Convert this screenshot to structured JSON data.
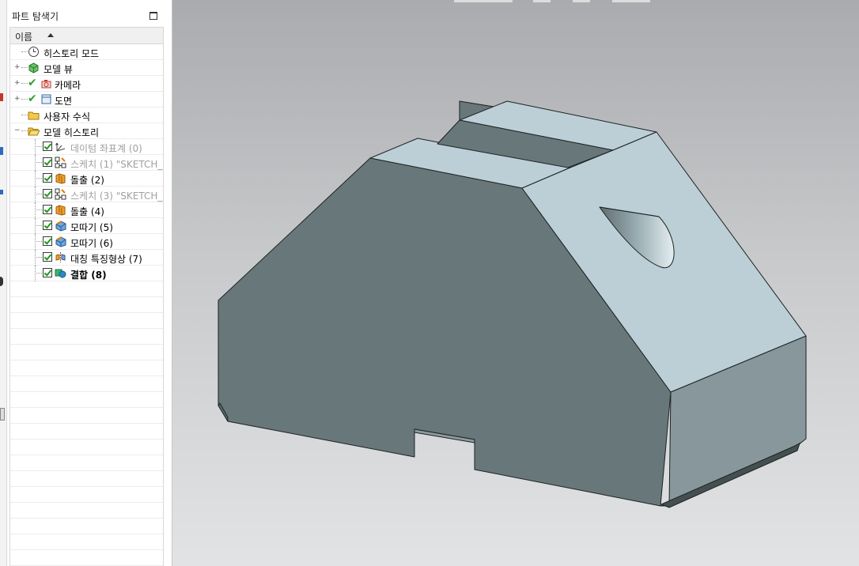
{
  "navigator": {
    "title": "파트 탐색기",
    "column_header": "이름",
    "rows": [
      {
        "label": "히스토리 모드",
        "icon": "clock-icon",
        "checked": false,
        "dim": false,
        "bold": false
      },
      {
        "label": "모델 뷰",
        "icon": "model-view-icon",
        "checked": false,
        "dim": false,
        "bold": false
      },
      {
        "label": "카메라",
        "icon": "camera-icon",
        "checked": true,
        "dim": false,
        "bold": false
      },
      {
        "label": "도면",
        "icon": "drawing-icon",
        "checked": true,
        "dim": false,
        "bold": false
      },
      {
        "label": "사용자 수식",
        "icon": "folder-icon",
        "checked": false,
        "dim": false,
        "bold": false
      },
      {
        "label": "모델 히스토리",
        "icon": "folder-open-icon",
        "checked": false,
        "dim": false,
        "bold": false
      },
      {
        "label": "데이텀 좌표계 (0)",
        "icon": "datum-csys-icon",
        "checked": true,
        "dim": true,
        "bold": false
      },
      {
        "label": "스케치 (1) \"SKETCH_...",
        "icon": "sketch-icon",
        "checked": true,
        "dim": true,
        "bold": false
      },
      {
        "label": "돌출 (2)",
        "icon": "extrude-icon",
        "checked": true,
        "dim": false,
        "bold": false
      },
      {
        "label": "스케치 (3) \"SKETCH_...",
        "icon": "sketch-icon",
        "checked": true,
        "dim": true,
        "bold": false
      },
      {
        "label": "돌출 (4)",
        "icon": "extrude-icon",
        "checked": true,
        "dim": false,
        "bold": false
      },
      {
        "label": "모따기 (5)",
        "icon": "chamfer-icon",
        "checked": true,
        "dim": false,
        "bold": false
      },
      {
        "label": "모따기 (6)",
        "icon": "chamfer-icon",
        "checked": true,
        "dim": false,
        "bold": false
      },
      {
        "label": "대칭 특징형상 (7)",
        "icon": "mirror-feature-icon",
        "checked": true,
        "dim": false,
        "bold": false
      },
      {
        "label": "결합 (8)",
        "icon": "unite-icon",
        "checked": true,
        "dim": false,
        "bold": true
      }
    ]
  },
  "colors": {
    "face_top": "#bccfd6",
    "face_front": "#68777a",
    "face_side": "#87979b",
    "edge": "#1e2224",
    "check_green": "#1a9a1a"
  }
}
